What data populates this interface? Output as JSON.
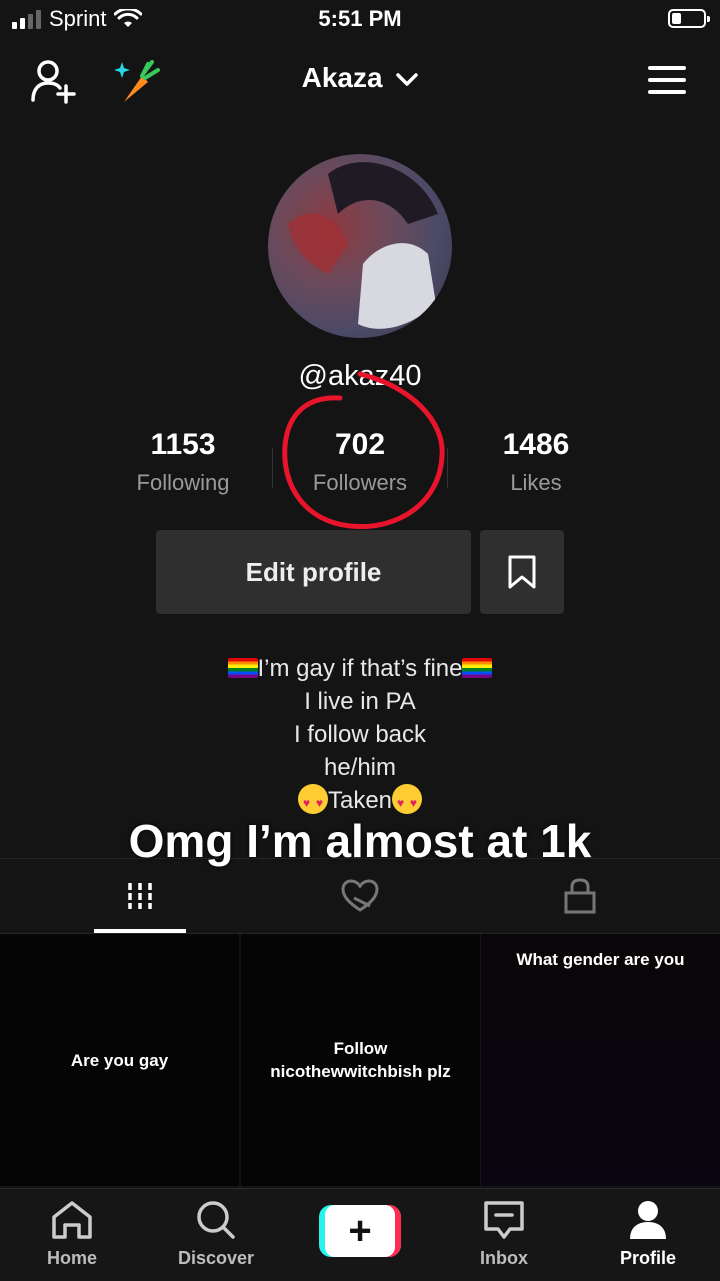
{
  "status_bar": {
    "carrier": "Sprint",
    "time": "5:51 PM"
  },
  "top_nav": {
    "title": "Akaza"
  },
  "profile": {
    "handle": "@akaz40",
    "stats": [
      {
        "value": "1153",
        "label": "Following"
      },
      {
        "value": "702",
        "label": "Followers"
      },
      {
        "value": "1486",
        "label": "Likes"
      }
    ],
    "edit_button": "Edit profile",
    "bio": {
      "line1": "I’m gay if that’s fine",
      "line2": "I live in PA",
      "line3": "I follow back",
      "line4": "he/him",
      "line5": "Taken"
    }
  },
  "overlay_caption": "Omg I’m almost at 1k",
  "videos": [
    {
      "caption": "Are you gay"
    },
    {
      "caption_line1": "Follow",
      "caption_line2": "nicothewwitchbish plz"
    },
    {
      "caption": "What gender are you"
    }
  ],
  "bottom_nav": {
    "home": "Home",
    "discover": "Discover",
    "inbox": "Inbox",
    "profile": "Profile"
  },
  "colors": {
    "annotation": "#e8142c",
    "background": "#141414"
  }
}
